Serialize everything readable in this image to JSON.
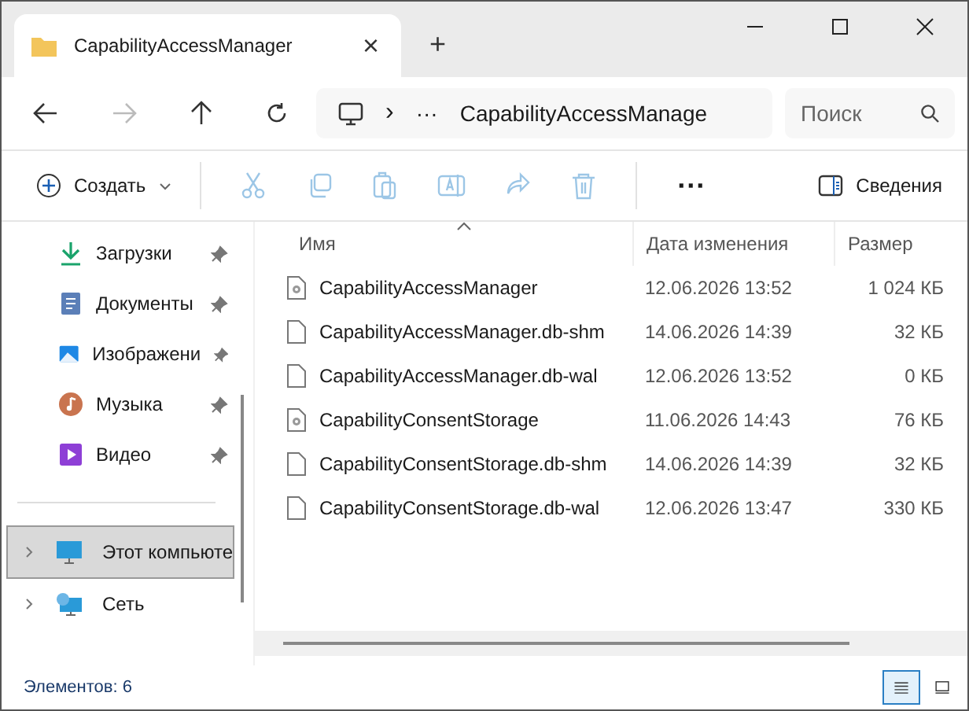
{
  "tab": {
    "title": "CapabilityAccessManager",
    "close": "×",
    "new": "+"
  },
  "breadcrumb": {
    "more": "···",
    "separator": "›",
    "path": "CapabilityAccessManage"
  },
  "search": {
    "placeholder": "Поиск"
  },
  "toolbar": {
    "create": "Создать",
    "more": "···",
    "details": "Сведения",
    "tools": [
      {
        "kind": "cut",
        "disabled": true
      },
      {
        "kind": "copy",
        "disabled": true
      },
      {
        "kind": "paste",
        "disabled": true
      },
      {
        "kind": "rename",
        "disabled": true
      },
      {
        "kind": "share",
        "disabled": true
      },
      {
        "kind": "delete",
        "disabled": true
      }
    ]
  },
  "sidebar": {
    "quick": [
      {
        "label": "Загрузки",
        "kind": "downloads",
        "pinned": true
      },
      {
        "label": "Документы",
        "kind": "documents",
        "pinned": true
      },
      {
        "label": "Изображени",
        "kind": "pictures",
        "pinned": true
      },
      {
        "label": "Музыка",
        "kind": "music",
        "pinned": true
      },
      {
        "label": "Видео",
        "kind": "video",
        "pinned": true
      }
    ],
    "roots": [
      {
        "label": "Этот компьюте",
        "kind": "computer",
        "selected": true,
        "expanded": false
      },
      {
        "label": "Сеть",
        "kind": "network",
        "selected": false,
        "expanded": false
      }
    ]
  },
  "table": {
    "columns": [
      "Имя",
      "Дата изменения",
      "Размер"
    ],
    "rows": [
      {
        "name": "CapabilityAccessManager",
        "kind": "settings",
        "date": "12.06.2026 13:52",
        "size": "1 024 КБ"
      },
      {
        "name": "CapabilityAccessManager.db-shm",
        "kind": "file",
        "date": "14.06.2026 14:39",
        "size": "32 КБ"
      },
      {
        "name": "CapabilityAccessManager.db-wal",
        "kind": "file",
        "date": "12.06.2026 13:52",
        "size": "0 КБ"
      },
      {
        "name": "CapabilityConsentStorage",
        "kind": "settings",
        "date": "11.06.2026 14:43",
        "size": "76 КБ"
      },
      {
        "name": "CapabilityConsentStorage.db-shm",
        "kind": "file",
        "date": "14.06.2026 14:39",
        "size": "32 КБ"
      },
      {
        "name": "CapabilityConsentStorage.db-wal",
        "kind": "file",
        "date": "12.06.2026 13:47",
        "size": "330 КБ"
      }
    ]
  },
  "status": {
    "count": "Элементов: 6",
    "views": [
      {
        "kind": "details",
        "selected": true
      },
      {
        "kind": "tiles",
        "selected": false
      }
    ]
  }
}
